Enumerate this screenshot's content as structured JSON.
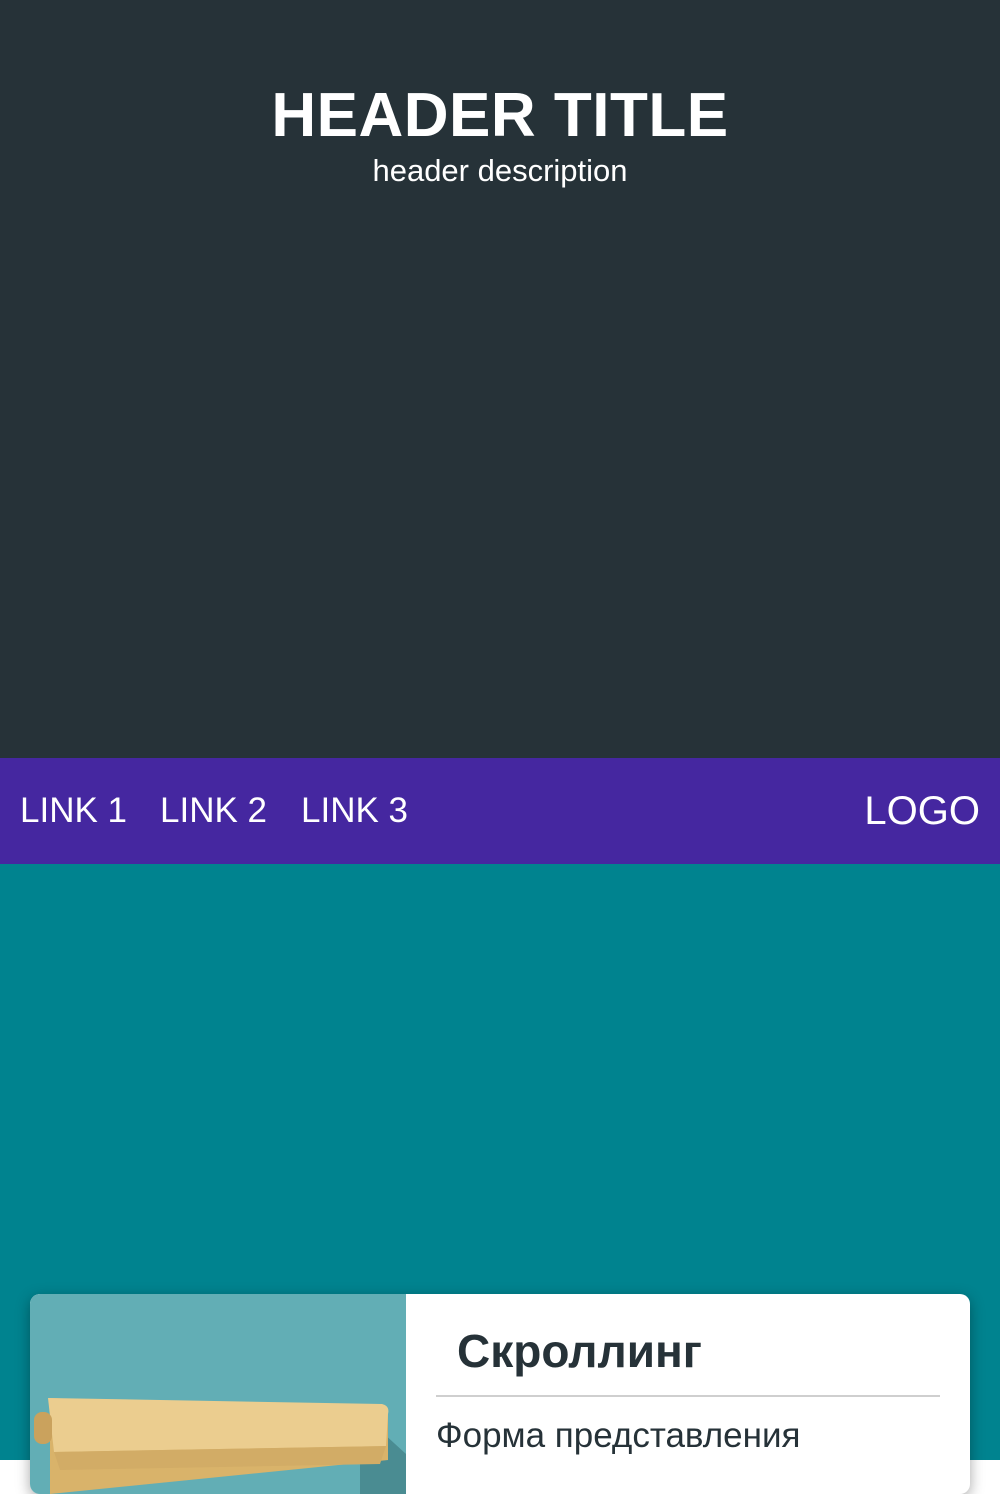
{
  "header": {
    "title": "HEADER TITLE",
    "description": "header description"
  },
  "navbar": {
    "links": [
      "LINK 1",
      "LINK 2",
      "LINK 3"
    ],
    "logo": "LOGO"
  },
  "card": {
    "image_icon": "scroll-icon",
    "title": "Скроллинг",
    "text": "Форма представления"
  },
  "colors": {
    "header_bg": "#263238",
    "navbar_bg": "#4527a0",
    "main_bg": "#00838f",
    "card_image_bg": "#62aeb5",
    "scroll_paper": "#ebcd8f"
  }
}
